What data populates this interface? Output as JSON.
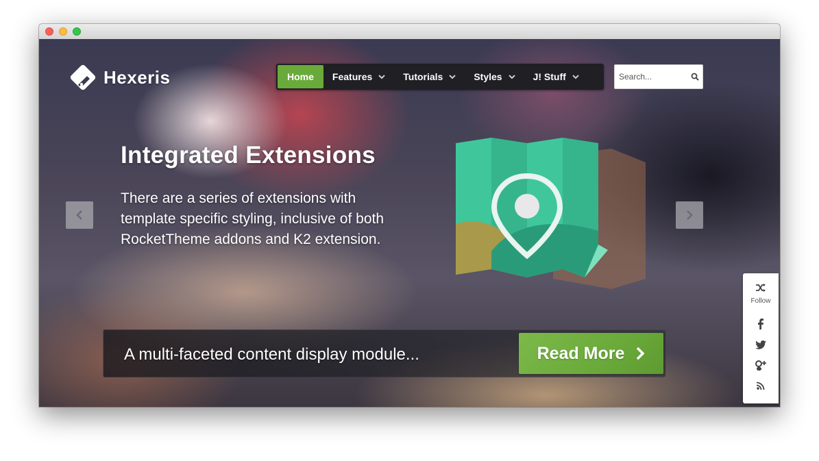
{
  "brand": {
    "name": "Hexeris"
  },
  "nav": {
    "items": [
      {
        "label": "Home",
        "active": true
      },
      {
        "label": "Features",
        "dropdown": true
      },
      {
        "label": "Tutorials",
        "dropdown": true
      },
      {
        "label": "Styles",
        "dropdown": true
      },
      {
        "label": "J! Stuff",
        "dropdown": true
      }
    ]
  },
  "search": {
    "placeholder": "Search..."
  },
  "slide": {
    "title": "Integrated Extensions",
    "description": "There are a series of extensions with template specific styling, inclusive of both RocketTheme addons and K2 extension."
  },
  "promo": {
    "text": "A multi-faceted content display module...",
    "button_label": "Read More"
  },
  "social": {
    "follow_label": "Follow",
    "icons": [
      "facebook-icon",
      "twitter-icon",
      "google-plus-icon",
      "rss-icon"
    ]
  },
  "colors": {
    "accent": "#6aaa3a",
    "nav_bg": "#1f1f24",
    "map_teal": "#3fc79b",
    "map_dark": "#2a9b78",
    "map_olive": "#a89a4a"
  }
}
